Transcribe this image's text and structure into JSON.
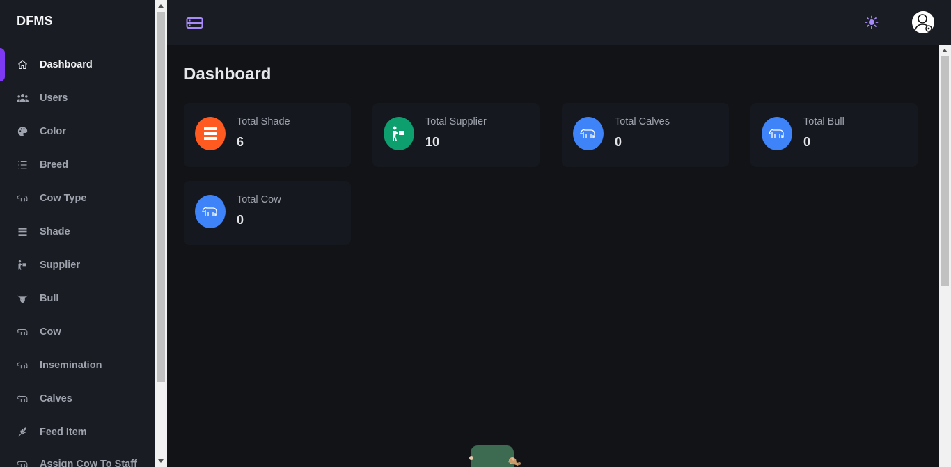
{
  "brand": "DFMS",
  "sidebar": {
    "items": [
      {
        "label": "Dashboard",
        "icon": "home-icon",
        "active": true
      },
      {
        "label": "Users",
        "icon": "users-icon"
      },
      {
        "label": "Color",
        "icon": "palette-icon"
      },
      {
        "label": "Breed",
        "icon": "list-icon"
      },
      {
        "label": "Cow Type",
        "icon": "cow-icon"
      },
      {
        "label": "Shade",
        "icon": "shade-icon"
      },
      {
        "label": "Supplier",
        "icon": "person-carry-icon"
      },
      {
        "label": "Bull",
        "icon": "bull-head-icon"
      },
      {
        "label": "Cow",
        "icon": "cow-icon"
      },
      {
        "label": "Insemination",
        "icon": "cow-icon"
      },
      {
        "label": "Calves",
        "icon": "cow-icon"
      },
      {
        "label": "Feed Item",
        "icon": "wheat-icon"
      },
      {
        "label": "Assign Cow To Staff",
        "icon": "cow-icon"
      }
    ]
  },
  "header": {
    "menu_icon": "menu-icon",
    "theme_icon": "sun-icon",
    "avatar_icon": "user-settings-avatar"
  },
  "main": {
    "title": "Dashboard",
    "cards": [
      {
        "label": "Total Shade",
        "value": "6",
        "icon": "shade-icon",
        "color": "#ff5a1f"
      },
      {
        "label": "Total Supplier",
        "value": "10",
        "icon": "person-carry-icon",
        "color": "#0e9f6e"
      },
      {
        "label": "Total Calves",
        "value": "0",
        "icon": "cow-icon",
        "color": "#3f83f8"
      },
      {
        "label": "Total Bull",
        "value": "0",
        "icon": "cow-icon",
        "color": "#3f83f8"
      },
      {
        "label": "Total Cow",
        "value": "0",
        "icon": "cow-icon",
        "color": "#3f83f8"
      }
    ]
  },
  "colors": {
    "accent": "#7e3af2",
    "sidebar_bg": "#1a1c23",
    "main_bg": "#121317"
  }
}
